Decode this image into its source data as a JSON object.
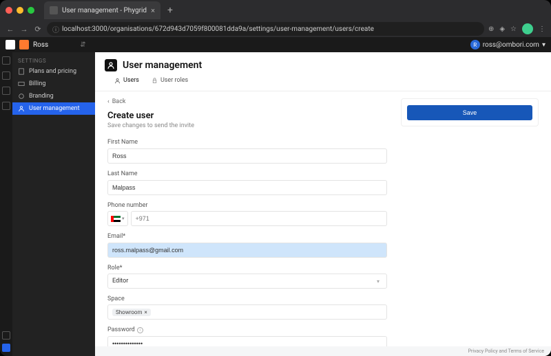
{
  "browser": {
    "tab_title": "User management - Phygrid",
    "url": "localhost:3000/organisations/672d943d7059f800081dda9a/settings/user-management/users/create"
  },
  "topbar": {
    "org": "Ross",
    "user_email": "ross@ombori.com",
    "user_initial": "R"
  },
  "sidebar": {
    "heading": "SETTINGS",
    "items": [
      {
        "label": "Plans and pricing"
      },
      {
        "label": "Billing"
      },
      {
        "label": "Branding"
      },
      {
        "label": "User management"
      }
    ]
  },
  "page": {
    "title": "User management",
    "tabs": [
      {
        "label": "Users"
      },
      {
        "label": "User roles"
      }
    ],
    "back_label": "Back"
  },
  "form": {
    "heading": "Create user",
    "subheading": "Save changes to send the invite",
    "first_name": {
      "label": "First Name",
      "value": "Ross"
    },
    "last_name": {
      "label": "Last Name",
      "value": "Malpass"
    },
    "phone": {
      "label": "Phone number",
      "prefix": "+971",
      "value": ""
    },
    "email": {
      "label": "Email*",
      "value": "ross.malpass@gmail.com"
    },
    "role": {
      "label": "Role*",
      "value": "Editor"
    },
    "space": {
      "label": "Space",
      "tag": "Showroom"
    },
    "password": {
      "label": "Password",
      "value": "••••••••••••••"
    }
  },
  "actions": {
    "save": "Save"
  },
  "footer": {
    "privacy": "Privacy Policy",
    "and": " and ",
    "terms": "Terms of Service"
  }
}
